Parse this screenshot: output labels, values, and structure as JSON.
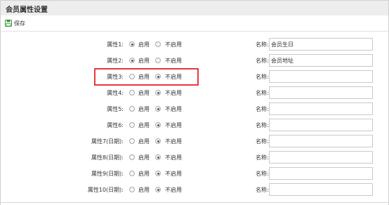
{
  "page": {
    "title": "会员属性设置"
  },
  "toolbar": {
    "save_label": "保存",
    "save_icon": "floppy-disk-icon",
    "save_icon_color": "#3a9a3a"
  },
  "radio_labels": {
    "enable": "启用",
    "disable": "不启用"
  },
  "name_label": "名称:",
  "highlight_color": "#e5393f",
  "attributes": [
    {
      "label": "属性1:",
      "enabled": true,
      "name": "会员生日"
    },
    {
      "label": "属性2:",
      "enabled": true,
      "name": "会员地址"
    },
    {
      "label": "属性3:",
      "enabled": false,
      "name": ""
    },
    {
      "label": "属性4:",
      "enabled": false,
      "name": ""
    },
    {
      "label": "属性5:",
      "enabled": false,
      "name": ""
    },
    {
      "label": "属性6:",
      "enabled": false,
      "name": ""
    },
    {
      "label": "属性7(日期):",
      "enabled": false,
      "name": ""
    },
    {
      "label": "属性8(日期):",
      "enabled": false,
      "name": ""
    },
    {
      "label": "属性9(日期):",
      "enabled": false,
      "name": ""
    },
    {
      "label": "属性10(日期):",
      "enabled": false,
      "name": ""
    }
  ]
}
